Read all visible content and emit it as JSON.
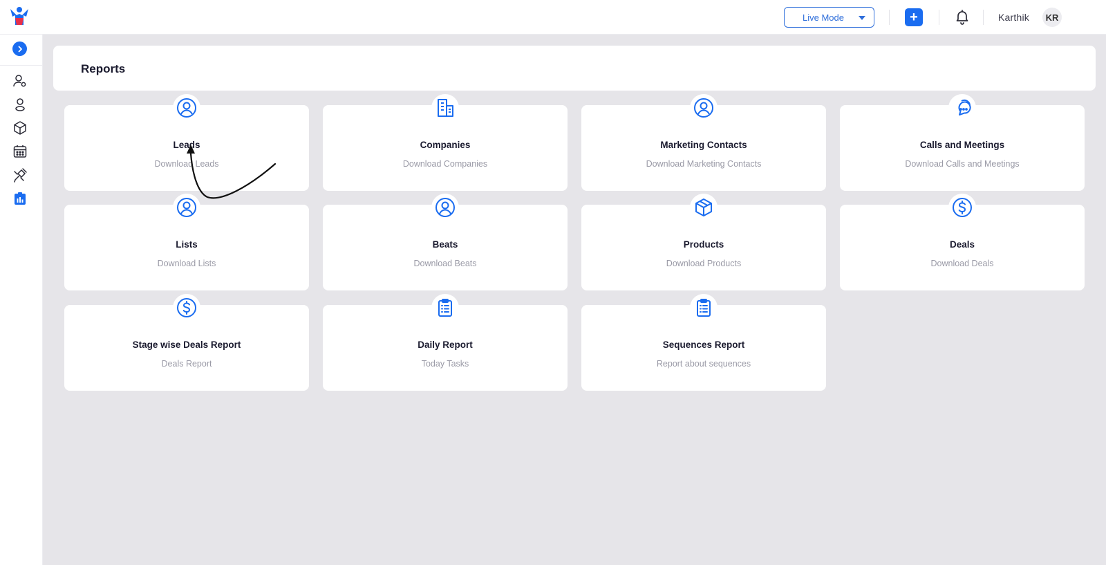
{
  "topbar": {
    "mode_label": "Live Mode",
    "add_label": "+",
    "user_name": "Karthik",
    "user_initials": "KR"
  },
  "page": {
    "title": "Reports"
  },
  "reports": [
    {
      "title": "Leads",
      "subtitle": "Download Leads",
      "icon": "user-circle-icon"
    },
    {
      "title": "Companies",
      "subtitle": "Download Companies",
      "icon": "building-icon"
    },
    {
      "title": "Marketing Contacts",
      "subtitle": "Download Marketing Contacts",
      "icon": "user-circle-icon"
    },
    {
      "title": "Calls and Meetings",
      "subtitle": "Download Calls and Meetings",
      "icon": "chat-bubbles-icon"
    },
    {
      "title": "Lists",
      "subtitle": "Download Lists",
      "icon": "user-circle-icon"
    },
    {
      "title": "Beats",
      "subtitle": "Download Beats",
      "icon": "user-circle-icon"
    },
    {
      "title": "Products",
      "subtitle": "Download Products",
      "icon": "cube-icon"
    },
    {
      "title": "Deals",
      "subtitle": "Download Deals",
      "icon": "dollar-circle-icon"
    },
    {
      "title": "Stage wise Deals Report",
      "subtitle": "Deals Report",
      "icon": "dollar-circle-icon"
    },
    {
      "title": "Daily Report",
      "subtitle": "Today Tasks",
      "icon": "clipboard-icon"
    },
    {
      "title": "Sequences Report",
      "subtitle": "Report about sequences",
      "icon": "clipboard-icon"
    }
  ],
  "colors": {
    "accent": "#1a6cf0",
    "background": "#e6e5e9",
    "card": "#ffffff",
    "muted_text": "#9a9aa6"
  }
}
